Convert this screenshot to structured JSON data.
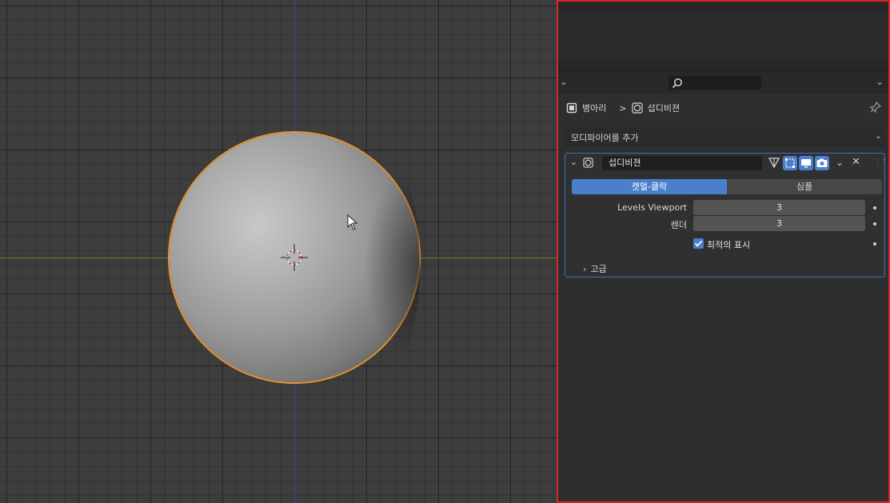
{
  "colors": {
    "accent": "#4a7fcb",
    "selection_outline": "#e8912e",
    "panel_border": "#d8262a"
  },
  "breadcrumb": {
    "object_name": "병아리",
    "separator": ">",
    "modifier_name": "섭디비젼",
    "object_icon": "mesh-object-icon",
    "modifier_icon": "subdivision-icon"
  },
  "add_modifier": {
    "label": "모디파이어를 추가"
  },
  "modifier": {
    "name": "섭디비젼",
    "type_icon": "subdivision-icon",
    "toggles": [
      "edit-mode-icon",
      "cage-icon",
      "viewport-icon",
      "render-camera-icon"
    ],
    "segments": [
      {
        "label": "캣멀-클락",
        "active": true
      },
      {
        "label": "심플",
        "active": false
      }
    ],
    "properties": [
      {
        "label": "Levels Viewport",
        "value": "3"
      },
      {
        "label": "렌더",
        "value": "3"
      }
    ],
    "optimal_display": {
      "label": "최적의 표시",
      "checked": true
    },
    "advanced": {
      "label": "고급"
    }
  }
}
